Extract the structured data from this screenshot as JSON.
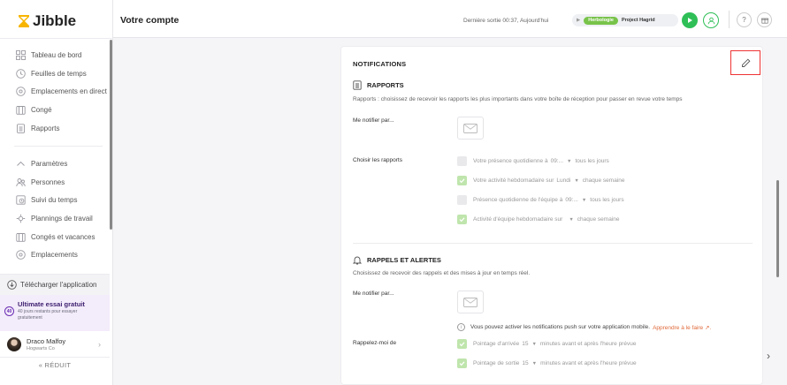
{
  "app": {
    "name": "Jibble"
  },
  "sidebar": {
    "primary": [
      {
        "label": "Tableau de bord",
        "icon": "dashboard-icon"
      },
      {
        "label": "Feuilles de temps",
        "icon": "clock-icon"
      },
      {
        "label": "Emplacements en direct",
        "icon": "location-icon"
      },
      {
        "label": "Congé",
        "icon": "calendar-icon"
      },
      {
        "label": "Rapports",
        "icon": "report-icon"
      }
    ],
    "settings": [
      {
        "label": "Paramètres",
        "icon": "chevron-up-icon"
      },
      {
        "label": "Personnes",
        "icon": "people-icon"
      },
      {
        "label": "Suivi du temps",
        "icon": "time-tracking-icon"
      },
      {
        "label": "Plannings de travail",
        "icon": "schedule-icon"
      },
      {
        "label": "Congés et vacances",
        "icon": "calendar-icon"
      },
      {
        "label": "Emplacements",
        "icon": "location-icon"
      }
    ],
    "download_label": "Télécharger l'application",
    "trial": {
      "badge": "40",
      "title": "Ultimate essai gratuit",
      "subtitle": "40 jours restants pour essayer gratuitement"
    },
    "user": {
      "name": "Draco Malfoy",
      "org": "Hogwarts Co"
    },
    "reduce_label": "« RÉDUIT"
  },
  "header": {
    "title": "Votre compte",
    "last_out": "Dernière sortie 00:37, Aujourd'hui",
    "activity_tag": "Herbologie",
    "project": "Project Hagrid"
  },
  "card": {
    "title": "NOTIFICATIONS",
    "reports": {
      "title": "RAPPORTS",
      "desc": "Rapports : choisissez de recevoir les rapports les plus importants dans votre boîte de réception pour passer en revue votre temps",
      "notify_label": "Me notifier par...",
      "choose_label": "Choisir les rapports",
      "options": [
        {
          "checked": false,
          "text": "Votre présence quotidienne à",
          "select": "09:...",
          "suffix": "tous les jours"
        },
        {
          "checked": true,
          "text": "Votre activité hebdomadaire sur",
          "select": "Lundi",
          "suffix": "chaque semaine"
        },
        {
          "checked": false,
          "text": "Présence quotidienne de l'équipe à",
          "select": "09:...",
          "suffix": "tous les jours"
        },
        {
          "checked": true,
          "text": "Activité d'équipe hebdomadaire sur",
          "select": "",
          "suffix": "chaque semaine"
        }
      ]
    },
    "reminders": {
      "title": "RAPPELS ET ALERTES",
      "desc": "Choisissez de recevoir des rappels et des mises à jour en temps réel.",
      "notify_label": "Me notifier par...",
      "push_info": "Vous pouvez activer les notifications push sur votre application mobile.",
      "learn_link": "Apprendre à le faire ↗.",
      "remind_label": "Rappelez-moi de",
      "options": [
        {
          "checked": true,
          "text": "Pointage d'arrivée",
          "select": "15",
          "suffix": "minutes avant et après l'heure prévue"
        },
        {
          "checked": true,
          "text": "Pointage de sortie",
          "select": "15",
          "suffix": "minutes avant et après l'heure prévue"
        }
      ]
    }
  }
}
